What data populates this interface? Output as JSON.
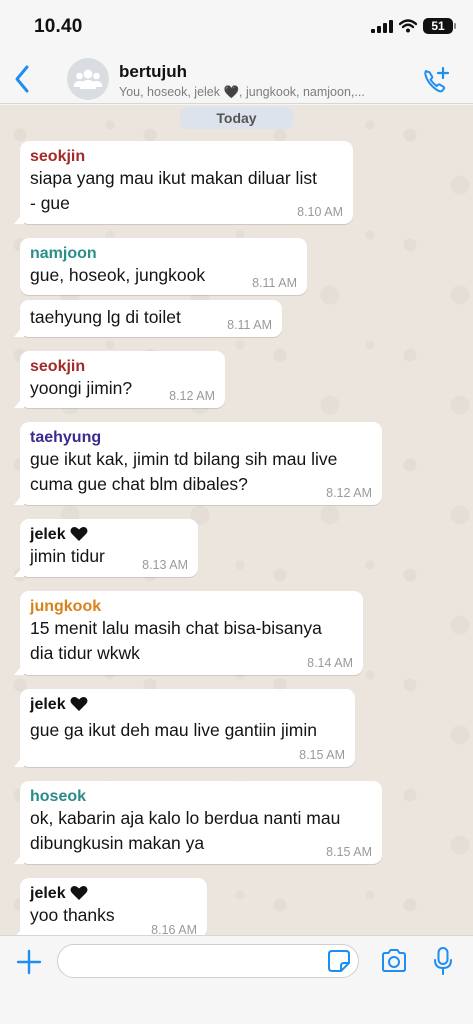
{
  "status_bar": {
    "time": "10.40",
    "battery": "51"
  },
  "header": {
    "group_name": "bertujuh",
    "members": "You, hoseok, jelek 🖤, jungkook, namjoon,..."
  },
  "date_chip": "Today",
  "colors": {
    "seokjin": "#a32a2a",
    "namjoon": "#2b8f8a",
    "taehyung": "#3a2b8f",
    "jelek": "#111111",
    "jungkook": "#d9821c",
    "hoseok": "#2b8a8a",
    "accent": "#1f8ef1"
  },
  "messages": [
    {
      "sender": "seokjin",
      "text": "siapa yang mau ikut makan diluar list\n- gue",
      "time": "8.10 AM"
    },
    {
      "sender": "namjoon",
      "text": "gue, hoseok, jungkook",
      "time": "8.11 AM"
    },
    {
      "sender": "",
      "text": "taehyung lg di toilet",
      "time": "8.11 AM"
    },
    {
      "sender": "seokjin",
      "text": "yoongi jimin?",
      "time": "8.12 AM"
    },
    {
      "sender": "taehyung",
      "text": "gue ikut kak, jimin td bilang sih mau live\ncuma gue chat blm dibales?",
      "time": "8.12 AM"
    },
    {
      "sender": "jelek",
      "text": "jimin tidur",
      "time": "8.13 AM"
    },
    {
      "sender": "jungkook",
      "text": "15 menit lalu masih chat bisa-bisanya\ndia tidur wkwk",
      "time": "8.14 AM"
    },
    {
      "sender": "jelek",
      "text": "gue ga ikut deh mau live gantiin jimin",
      "time": "8.15 AM"
    },
    {
      "sender": "hoseok",
      "text": "ok, kabarin aja kalo lo berdua nanti mau\ndibungkusin makan ya",
      "time": "8.15 AM"
    },
    {
      "sender": "jelek",
      "text": "yoo thanks",
      "time": "8.16 AM"
    }
  ],
  "icons": [
    "back-chevron-icon",
    "group-avatar-icon",
    "call-add-icon",
    "plus-icon",
    "sticker-icon",
    "camera-icon",
    "mic-icon",
    "black-heart-icon"
  ]
}
